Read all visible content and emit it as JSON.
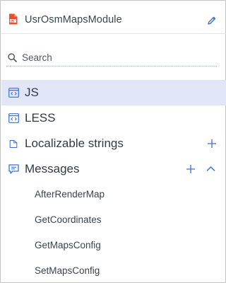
{
  "header": {
    "module_name": "UsrOsmMapsModule",
    "icon": "js-file-icon",
    "edit_icon": "pencil-icon"
  },
  "search": {
    "placeholder": "Search",
    "value": ""
  },
  "tree": [
    {
      "label": "JS",
      "icon": "code-window-icon",
      "selected": true
    },
    {
      "label": "LESS",
      "icon": "code-window-icon",
      "selected": false
    },
    {
      "label": "Localizable strings",
      "icon": "document-icon",
      "selected": false,
      "action": "plus-icon"
    },
    {
      "label": "Messages",
      "icon": "message-icon",
      "selected": false,
      "action": "plus-icon",
      "expanded": true,
      "children": [
        "AfterRenderMap",
        "GetCoordinates",
        "GetMapsConfig",
        "SetMapsConfig"
      ]
    }
  ],
  "colors": {
    "accent": "#3a6fd8",
    "selected_bg": "#e1e6f7",
    "js_icon": "#e2522e",
    "text": "#333a42"
  }
}
